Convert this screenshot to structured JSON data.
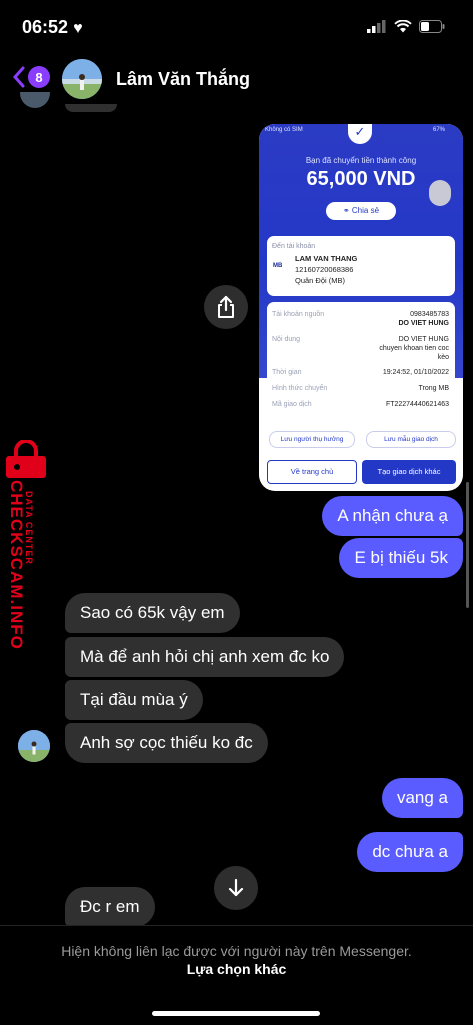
{
  "status_bar": {
    "time": "06:52"
  },
  "header": {
    "contact_name": "Lâm Văn Thắng",
    "unread_count": "8"
  },
  "receipt": {
    "status_left": "Không có SIM",
    "status_right": "67%",
    "message": "Bạn đã chuyển tiền thành công",
    "amount": "65,000 VND",
    "share_label": "Chia sẻ",
    "to_account_label": "Đến tài khoản",
    "recipient_name": "LAM VAN THANG",
    "recipient_account": "12160720068386",
    "recipient_bank": "Quân Đội (MB)",
    "bank_logo": "MB",
    "rows": [
      {
        "label": "Tài khoản nguồn",
        "value": "0983485783",
        "value2": "DO VIET HUNG"
      },
      {
        "label": "Nội dung",
        "value": "DO VIET HUNG",
        "value2": "chuyen khoan tien coc",
        "value3": "kèo"
      },
      {
        "label": "Thời gian",
        "value": "19:24:52, 01/10/2022"
      },
      {
        "label": "Hình thức chuyển",
        "value": "Trong MB"
      },
      {
        "label": "Mã giao dịch",
        "value": "FT22274440621463"
      }
    ],
    "save_recipient": "Lưu người thụ hưởng",
    "save_template": "Lưu mẫu giao dịch",
    "home_button": "Về trang chủ",
    "new_tx_button": "Tạo giao dịch khác"
  },
  "messages": {
    "out_1": "A nhận chưa ạ",
    "out_2": "E bị thiếu 5k",
    "in_1": "Sao có 65k vậy em",
    "in_2": "Mà để anh hỏi chị anh xem đc ko",
    "in_3": "Tại đầu mùa ý",
    "in_4": "Anh sợ cọc thiếu ko đc",
    "out_3": "vang a",
    "out_4": "dc chưa a",
    "in_5": "Đc r em"
  },
  "watermark": {
    "text": "CHECKSCAM.INFO",
    "sub": "DATA CENTER"
  },
  "footer": {
    "notice": "Hiện không liên lạc được với người này trên Messenger.",
    "link": "Lựa chọn khác"
  }
}
